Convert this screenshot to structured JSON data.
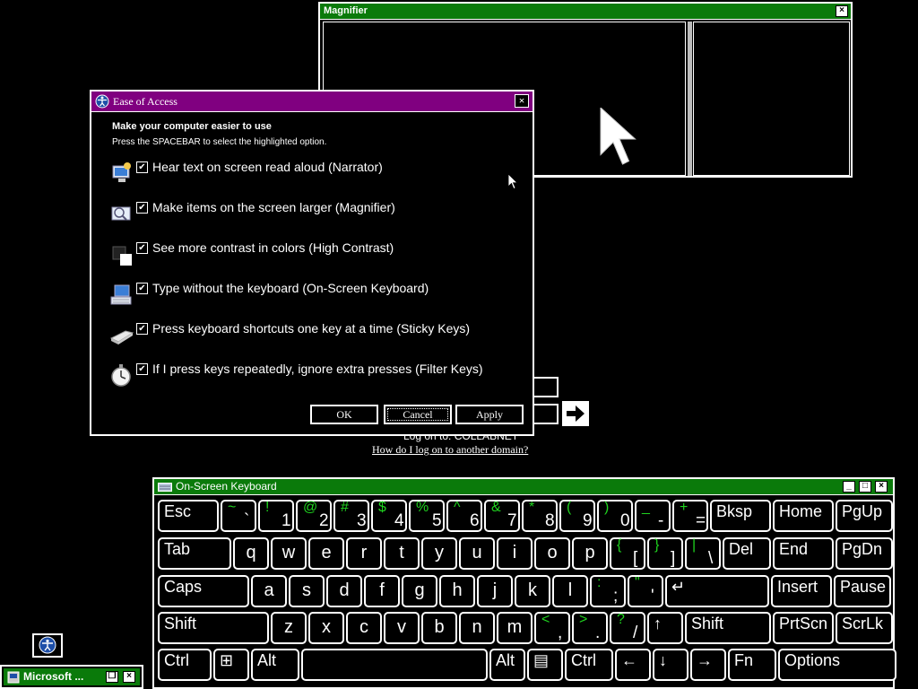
{
  "magnifier": {
    "title": "Magnifier",
    "close": "×"
  },
  "logon": {
    "log_on_to": "Log on to: COLLABNET",
    "other_domain": "How do I log on to another domain?"
  },
  "ease": {
    "title": "Ease of Access",
    "close": "×",
    "heading": "Make your computer easier to use",
    "subtext": "Press the SPACEBAR to select the highlighted option.",
    "options": [
      {
        "label": "Hear text on screen read aloud (Narrator)",
        "icon": "narrator-icon",
        "checked": true
      },
      {
        "label": "Make items on the screen larger (Magnifier)",
        "icon": "magnifier-icon",
        "checked": true
      },
      {
        "label": "See more contrast in colors (High Contrast)",
        "icon": "high-contrast-icon",
        "checked": true
      },
      {
        "label": "Type without the keyboard (On-Screen Keyboard)",
        "icon": "keyboard-icon",
        "checked": true
      },
      {
        "label": "Press keyboard shortcuts one key at a time (Sticky Keys)",
        "icon": "sticky-keys-icon",
        "checked": true
      },
      {
        "label": "If I press keys repeatedly, ignore extra presses (Filter Keys)",
        "icon": "stopwatch-icon",
        "checked": true
      }
    ],
    "ok": "OK",
    "cancel": "Cancel",
    "apply": "Apply"
  },
  "osk": {
    "title": "On-Screen Keyboard",
    "rows": [
      [
        {
          "m": "Esc"
        },
        {
          "s": "~",
          "l": "`"
        },
        {
          "s": "!",
          "l": "1"
        },
        {
          "s": "@",
          "l": "2"
        },
        {
          "s": "#",
          "l": "3"
        },
        {
          "s": "$",
          "l": "4"
        },
        {
          "s": "%",
          "l": "5"
        },
        {
          "s": "^",
          "l": "6"
        },
        {
          "s": "&",
          "l": "7"
        },
        {
          "s": "*",
          "l": "8"
        },
        {
          "s": "(",
          "l": "9"
        },
        {
          "s": ")",
          "l": "0"
        },
        {
          "s": "_",
          "l": "-"
        },
        {
          "s": "+",
          "l": "="
        },
        {
          "m": "Bksp"
        },
        {
          "m": "Home"
        },
        {
          "m": "PgUp"
        }
      ],
      [
        {
          "m": "Tab"
        },
        {
          "c": "q"
        },
        {
          "c": "w"
        },
        {
          "c": "e"
        },
        {
          "c": "r"
        },
        {
          "c": "t"
        },
        {
          "c": "y"
        },
        {
          "c": "u"
        },
        {
          "c": "i"
        },
        {
          "c": "o"
        },
        {
          "c": "p"
        },
        {
          "s": "{",
          "l": "["
        },
        {
          "s": "}",
          "l": "]"
        },
        {
          "s": "|",
          "l": "\\"
        },
        {
          "m": "Del"
        },
        {
          "m": "End"
        },
        {
          "m": "PgDn"
        }
      ],
      [
        {
          "m": "Caps"
        },
        {
          "c": "a"
        },
        {
          "c": "s"
        },
        {
          "c": "d"
        },
        {
          "c": "f"
        },
        {
          "c": "g"
        },
        {
          "c": "h"
        },
        {
          "c": "j"
        },
        {
          "c": "k"
        },
        {
          "c": "l"
        },
        {
          "s": ":",
          "l": ";"
        },
        {
          "s": "\"",
          "l": "'"
        },
        {
          "m": "↵"
        },
        {
          "m": "Insert"
        },
        {
          "m": "Pause"
        }
      ],
      [
        {
          "m": "Shift"
        },
        {
          "c": "z"
        },
        {
          "c": "x"
        },
        {
          "c": "c"
        },
        {
          "c": "v"
        },
        {
          "c": "b"
        },
        {
          "c": "n"
        },
        {
          "c": "m"
        },
        {
          "s": "<",
          "l": ","
        },
        {
          "s": ">",
          "l": "."
        },
        {
          "s": "?",
          "l": "/"
        },
        {
          "m": "↑"
        },
        {
          "m": "Shift"
        },
        {
          "m": "PrtScn"
        },
        {
          "m": "ScrLk"
        }
      ],
      [
        {
          "m": "Ctrl"
        },
        {
          "m": "⊞"
        },
        {
          "m": "Alt"
        },
        {
          "m": ""
        },
        {
          "m": "Alt"
        },
        {
          "m": "▤"
        },
        {
          "m": "Ctrl"
        },
        {
          "m": "←"
        },
        {
          "m": "↓"
        },
        {
          "m": "→"
        },
        {
          "m": "Fn"
        },
        {
          "m": "Options"
        }
      ]
    ]
  },
  "taskbar": {
    "app_label": "Microsoft ..."
  }
}
